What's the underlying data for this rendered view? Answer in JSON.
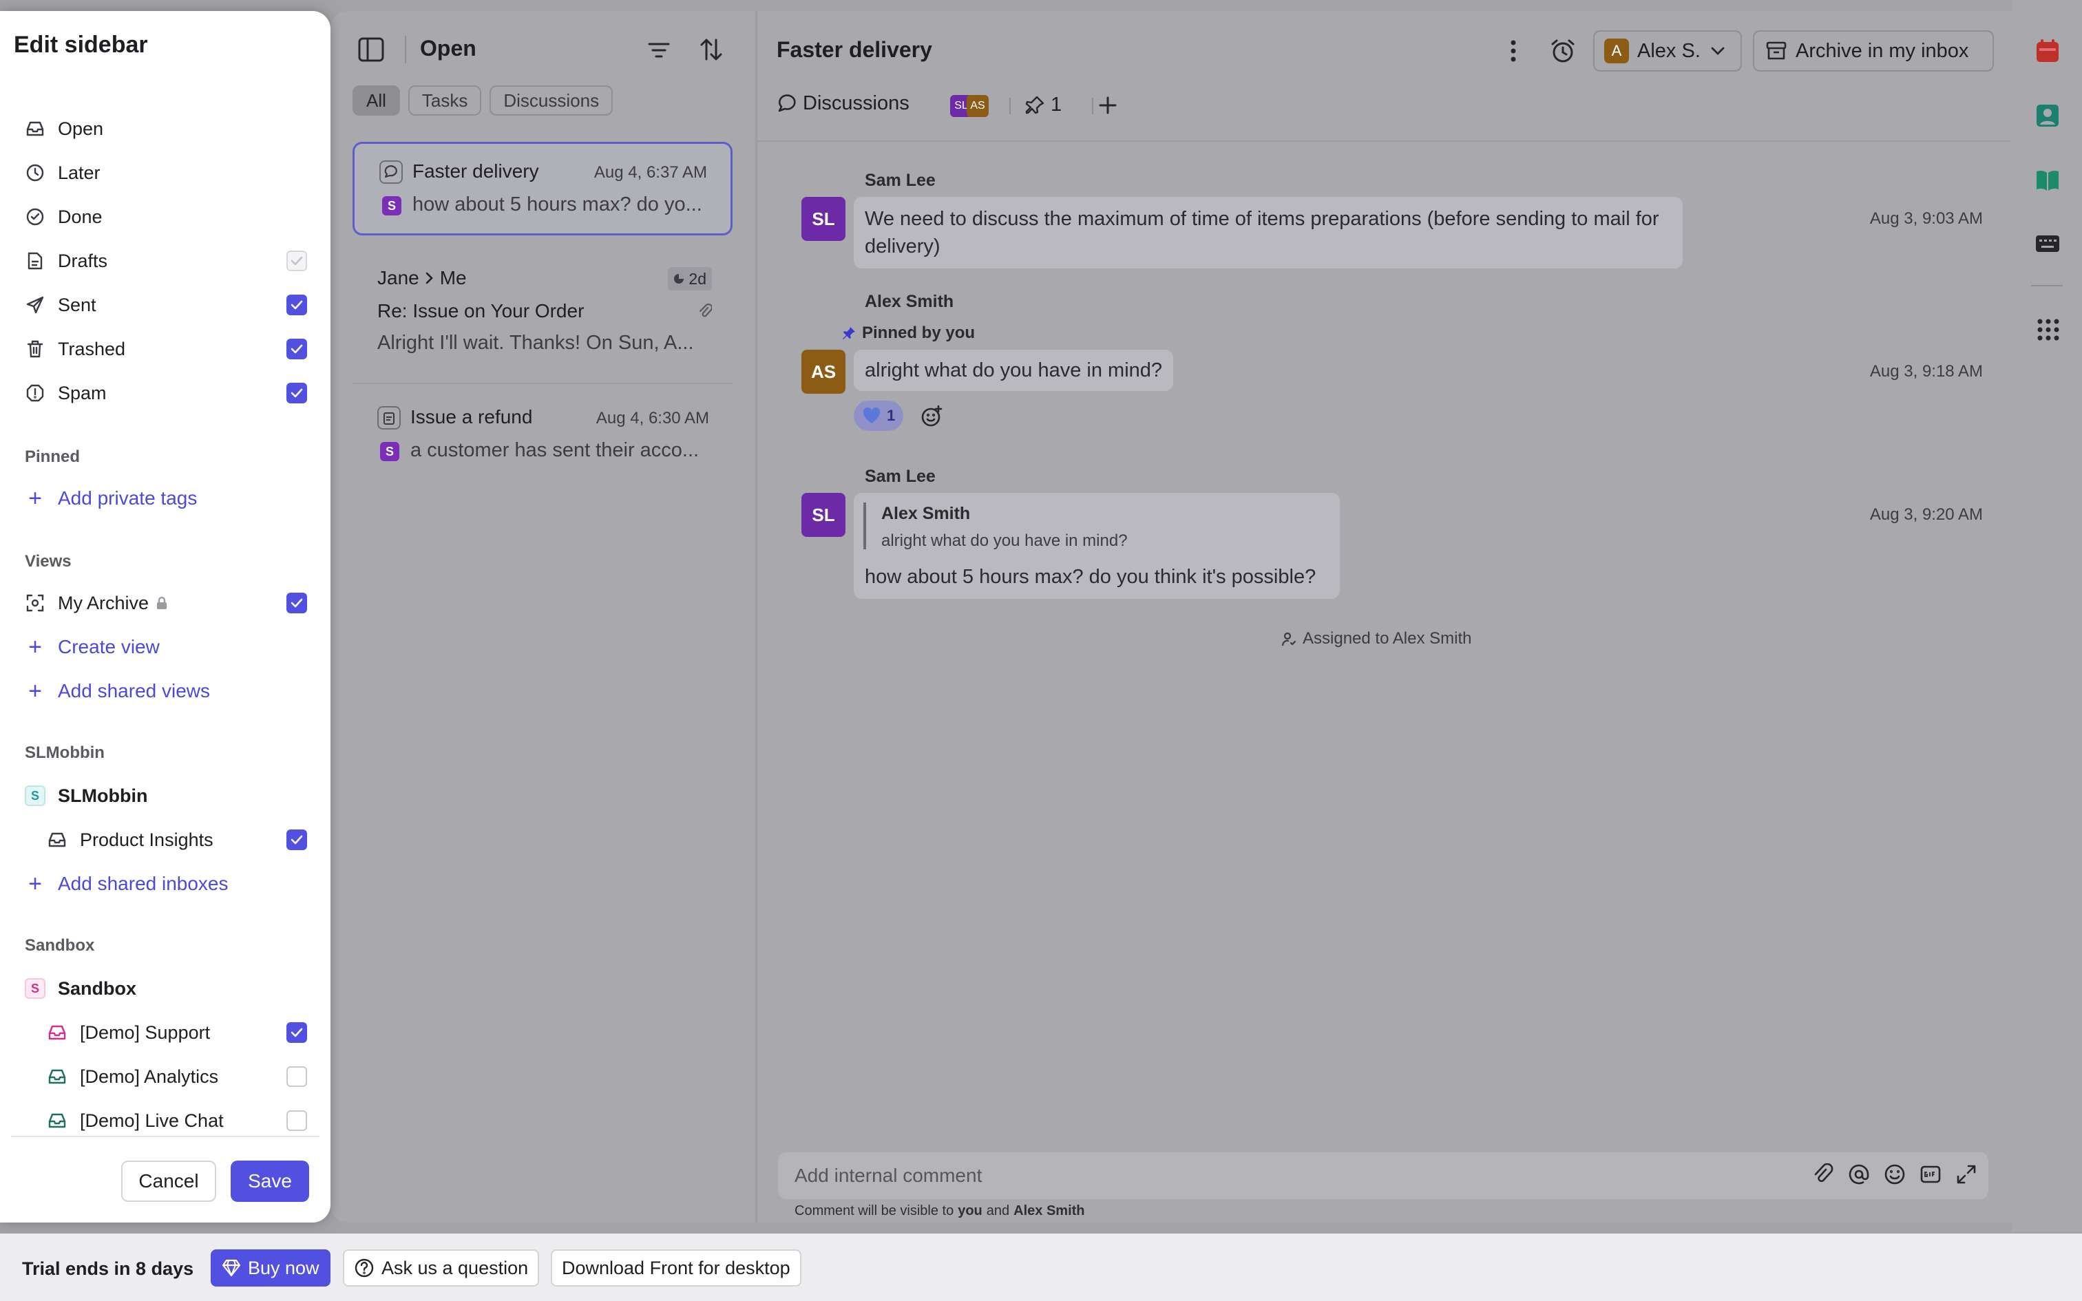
{
  "colors": {
    "accent": "#5150e0",
    "avatar_sam": "#6d2aa6",
    "avatar_alex": "#8c5c14",
    "badge_slmobbin": "#1a9aa0",
    "badge_sandbox": "#d0308a"
  },
  "sidebar": {
    "title": "Edit sidebar",
    "system_items": [
      {
        "label": "Open",
        "icon": "inbox-icon",
        "checkbox": "none"
      },
      {
        "label": "Later",
        "icon": "clock-icon",
        "checkbox": "none"
      },
      {
        "label": "Done",
        "icon": "check-circle-icon",
        "checkbox": "none"
      },
      {
        "label": "Drafts",
        "icon": "document-icon",
        "checkbox": "disabled-checked"
      },
      {
        "label": "Sent",
        "icon": "send-icon",
        "checkbox": "checked"
      },
      {
        "label": "Trashed",
        "icon": "trash-icon",
        "checkbox": "checked"
      },
      {
        "label": "Spam",
        "icon": "spam-icon",
        "checkbox": "checked"
      }
    ],
    "pinned": {
      "header": "Pinned",
      "add_label": "Add private tags"
    },
    "views": {
      "header": "Views",
      "items": [
        {
          "label": "My Archive",
          "icon": "view-icon",
          "locked": true,
          "checkbox": "checked"
        }
      ],
      "create_label": "Create view",
      "add_shared_label": "Add shared views"
    },
    "team_slmobbin": {
      "header": "SLMobbin",
      "badge": "S",
      "name": "SLMobbin",
      "inboxes": [
        {
          "label": "Product Insights",
          "checkbox": "checked"
        }
      ],
      "add_label": "Add shared inboxes"
    },
    "team_sandbox": {
      "header": "Sandbox",
      "badge": "S",
      "name": "Sandbox",
      "inboxes": [
        {
          "label": "[Demo] Support",
          "checkbox": "checked"
        },
        {
          "label": "[Demo] Analytics",
          "checkbox": "unchecked"
        },
        {
          "label": "[Demo] Live Chat",
          "checkbox": "unchecked"
        }
      ]
    },
    "cancel_label": "Cancel",
    "save_label": "Save"
  },
  "list": {
    "title": "Open",
    "tabs": [
      "All",
      "Tasks",
      "Discussions"
    ],
    "active_tab": "All",
    "conversations": [
      {
        "title": "Faster delivery",
        "time": "Aug 4, 6:37 AM",
        "badge": "S",
        "preview": "how about 5 hours max? do yo...",
        "selected": true,
        "icon": "discussion-icon"
      },
      {
        "from": "Jane",
        "to": "Me",
        "age": "2d",
        "subject": "Re: Issue on Your Order",
        "preview": "Alright I'll wait. Thanks! On Sun, A...",
        "has_attachment": true
      },
      {
        "title": "Issue a refund",
        "time": "Aug 4, 6:30 AM",
        "badge": "S",
        "preview": "a customer has sent their acco...",
        "icon": "task-icon"
      }
    ]
  },
  "conversation": {
    "title": "Faster delivery",
    "assignee_initial": "A",
    "assignee": "Alex S.",
    "archive_label": "Archive in my inbox",
    "tab_discussions": "Discussions",
    "participants": [
      "SL",
      "AS"
    ],
    "pinned_count": "1",
    "messages": [
      {
        "author": "Sam Lee",
        "initials": "SL",
        "text": "We need to discuss the maximum of time of items preparations (before sending to mail for delivery)",
        "time": "Aug 3, 9:03 AM"
      },
      {
        "author": "Alex Smith",
        "initials": "AS",
        "pinned_note": "Pinned by you",
        "text": "alright what do you have in mind?",
        "time": "Aug 3, 9:18 AM",
        "reaction": "1"
      },
      {
        "author": "Sam Lee",
        "initials": "SL",
        "quote_author": "Alex Smith",
        "quote_text": "alright what do you have in mind?",
        "text": "how about 5 hours max? do you think it's possible?",
        "time": "Aug 3, 9:20 AM"
      }
    ],
    "event": "Assigned to Alex Smith",
    "composer_placeholder": "Add internal comment",
    "visibility_prefix": "Comment will be visible to",
    "visibility_you": "you",
    "visibility_and": "and",
    "visibility_other": "Alex Smith"
  },
  "bottom_bar": {
    "trial": "Trial ends in 8 days",
    "buy": "Buy now",
    "ask": "Ask us a question",
    "download": "Download Front for desktop"
  }
}
